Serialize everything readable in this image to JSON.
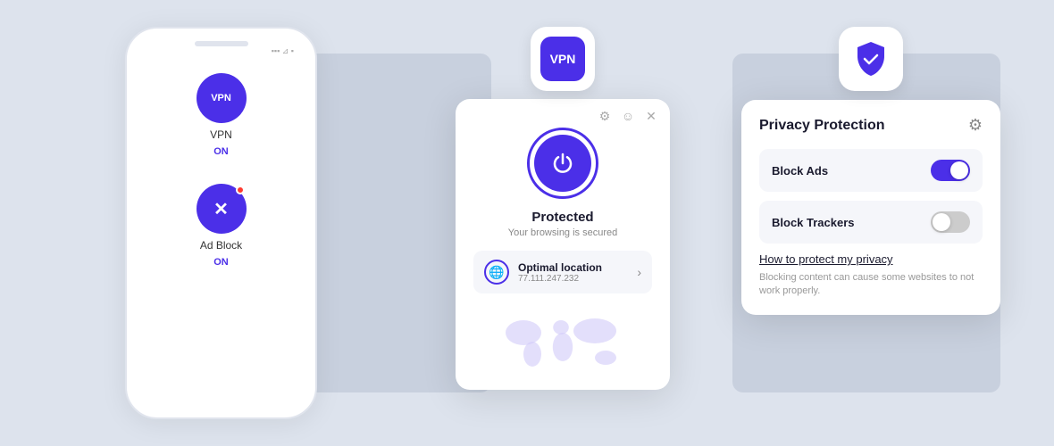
{
  "background": {
    "color": "#dde3ed"
  },
  "phone": {
    "status": "●●● ▲ ◼",
    "apps": [
      {
        "id": "vpn",
        "label": "VPN",
        "status": "ON",
        "icon_text": "VPN",
        "has_notification": false
      },
      {
        "id": "adblock",
        "label": "Ad Block",
        "status": "ON",
        "icon_text": "✕",
        "has_notification": true
      }
    ]
  },
  "vpn_popup": {
    "app_icon_label": "VPN",
    "header_icons": [
      "gear",
      "emoji",
      "close"
    ],
    "status_title": "Protected",
    "status_subtitle": "Your browsing is secured",
    "location": {
      "name": "Optimal location",
      "ip": "77.111.247.232"
    },
    "power_button_label": "power"
  },
  "privacy_popup": {
    "title": "Privacy Protection",
    "options": [
      {
        "label": "Block Ads",
        "enabled": true
      },
      {
        "label": "Block Trackers",
        "enabled": false
      }
    ],
    "link_text": "How to protect my privacy",
    "note": "Blocking content can cause some websites to not work properly."
  }
}
